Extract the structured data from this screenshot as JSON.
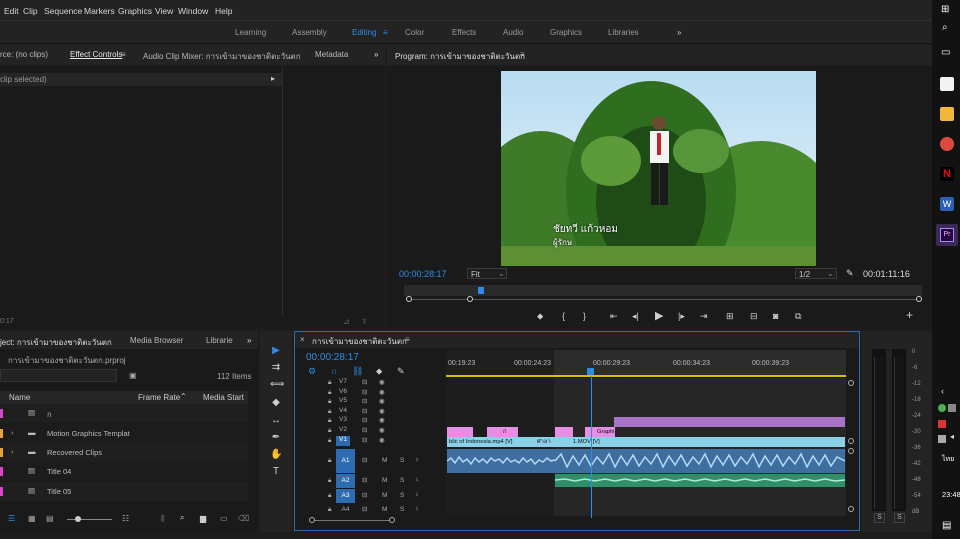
{
  "menu": [
    "Edit",
    "Clip",
    "Sequence",
    "Markers",
    "Graphics",
    "View",
    "Window",
    "Help"
  ],
  "workspaces": [
    "Learning",
    "Assembly",
    "Editing",
    "Color",
    "Effects",
    "Audio",
    "Graphics",
    "Libraries"
  ],
  "workspace_active": "Editing",
  "workspace_more": "»",
  "source_panel": {
    "tabs": [
      "rce: (no clips)",
      "Effect Controls",
      "Audio Clip Mixer: การเข้ามาของชาติตะวันตก",
      "Metadata"
    ],
    "no_clip": "clip selected)",
    "time": "0:17"
  },
  "program": {
    "title": "Program: การเข้ามาของชาติตะวันตก",
    "timecode": "00:00:28:17",
    "fit": "Fit",
    "resolution": "1/2",
    "duration": "00:01:11:16",
    "subtitle_line1": "ชัยทวี แก้วหอม",
    "subtitle_line2": "ผู้รักษ"
  },
  "project": {
    "tabs": [
      "ject: การเข้ามาของชาติตะวันตก",
      "Media Browser",
      "Librarie"
    ],
    "file": "การเข้ามาของชาติตะวันตก.prproj",
    "items_count": "112 Items",
    "columns": [
      "Name",
      "Frame Rate",
      "Media Start"
    ],
    "items": [
      {
        "name": "ก",
        "color": "#d946c8"
      },
      {
        "name": "Motion Graphics Templat",
        "color": "#e8a33a"
      },
      {
        "name": "Recovered Clips",
        "color": "#e8a33a"
      },
      {
        "name": "Title 04",
        "color": "#d946c8"
      },
      {
        "name": "Title 05",
        "color": "#d946c8"
      }
    ]
  },
  "timeline": {
    "title": "การเข้ามาของชาติตะวันตก",
    "timecode": "00:00:28:17",
    "ruler": [
      "00:19:23",
      "00:00:24:23",
      "00:00:29:23",
      "00:00:34:23",
      "00:00:39:23"
    ],
    "video_tracks": [
      "V7",
      "V6",
      "V5",
      "V4",
      "V3",
      "V2",
      "V1"
    ],
    "audio_tracks": [
      "A1",
      "A2",
      "A3",
      "A4"
    ],
    "clip_labels": {
      "v1a": "blic of Indonesia.mp4 [V]",
      "v1b": "ศาลา",
      "v1c": "1.MOV [V]",
      "v2": "Graphi",
      "v2b": "ก"
    }
  },
  "meter": {
    "scale": [
      "0",
      "-6",
      "-12",
      "-18",
      "-24",
      "-30",
      "-36",
      "-42",
      "-48",
      "-54",
      "dB"
    ],
    "solo": [
      "S",
      "S"
    ]
  },
  "taskbar": {
    "lang": "ไทย",
    "clock": "23:48"
  }
}
